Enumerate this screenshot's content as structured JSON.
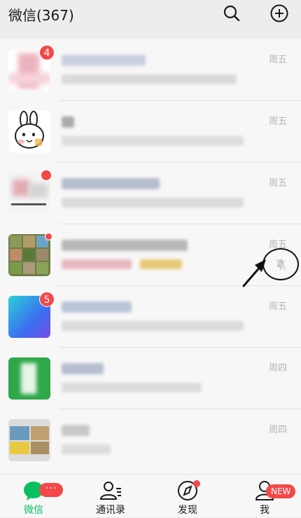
{
  "header": {
    "title": "微信(367)",
    "search_icon": "search-icon",
    "add_icon": "plus-circle-icon"
  },
  "chats": [
    {
      "time": "周五",
      "badge": "4",
      "avatar_color": "#f3c5cc"
    },
    {
      "time": "周五",
      "badge": "",
      "avatar_color": "#ffffff"
    },
    {
      "time": "周五",
      "badge": "",
      "has_badge_partial": true,
      "avatar_color": "#f0f0f0"
    },
    {
      "time": "周五",
      "badge": "",
      "dot": true,
      "muted": true,
      "avatar_color": "#7a8a4a"
    },
    {
      "time": "周五",
      "badge": "5",
      "avatar_color": "#2a7be0"
    },
    {
      "time": "周四",
      "badge": "",
      "avatar_color": "#2fa84a"
    },
    {
      "time": "周四",
      "badge": "",
      "avatar_color": "#d8d8d8"
    }
  ],
  "tabs": [
    {
      "label": "微信",
      "icon": "chat-bubble-icon",
      "active": true,
      "badge": "···"
    },
    {
      "label": "通讯录",
      "icon": "contacts-icon",
      "active": false
    },
    {
      "label": "发现",
      "icon": "compass-icon",
      "active": false,
      "dot": true
    },
    {
      "label": "我",
      "icon": "person-icon",
      "active": false,
      "badge": "NEW"
    }
  ],
  "colors": {
    "accent": "#07c160",
    "badge": "#f44848",
    "time_text": "#b4b4b4"
  }
}
